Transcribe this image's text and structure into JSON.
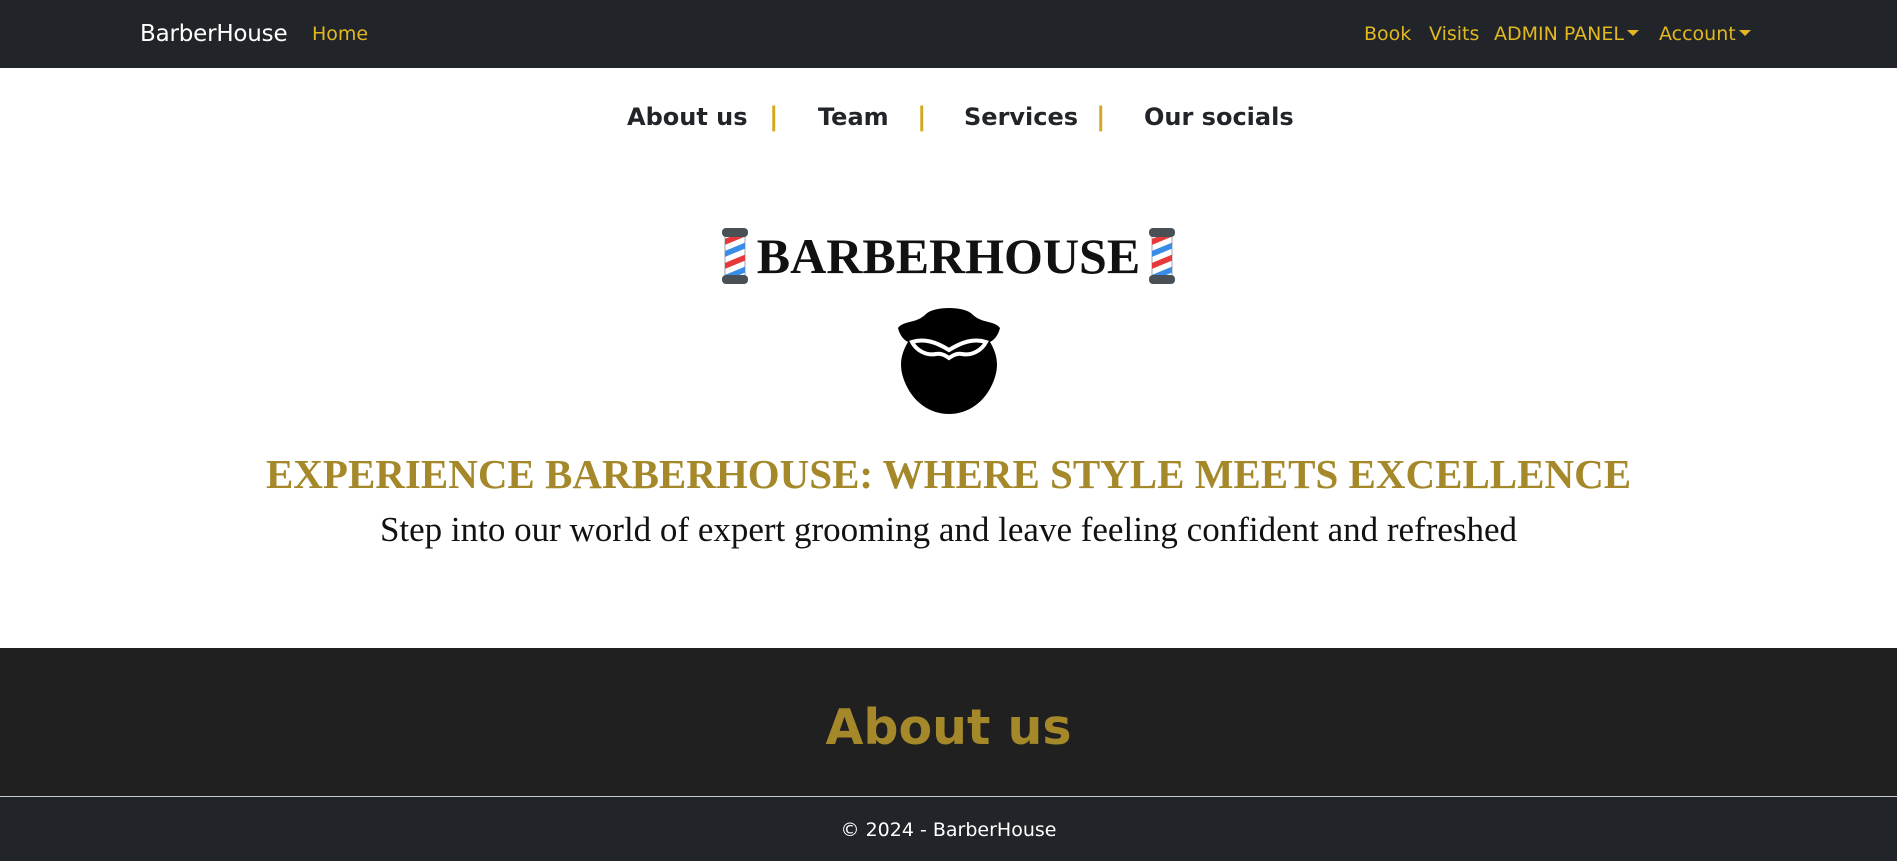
{
  "navbar": {
    "brand": "BarberHouse",
    "links": {
      "home": "Home",
      "book": "Book",
      "visits": "Visits",
      "admin": "ADMIN PANEL",
      "account": "Account"
    }
  },
  "section_nav": {
    "items": [
      "About us",
      "Team",
      "Services",
      "Our socials"
    ],
    "separator": "|"
  },
  "hero": {
    "title": "BARBERHOUSE",
    "heading": "EXPERIENCE BARBERHOUSE: WHERE STYLE MEETS EXCELLENCE",
    "subheading": "Step into our world of expert grooming and leave feeling confident and refreshed",
    "icons": [
      "barber-pole-icon",
      "beard-icon"
    ]
  },
  "about": {
    "title": "About us"
  },
  "footer": {
    "text": "© 2024 - BarberHouse"
  },
  "colors": {
    "navbar_bg": "#212529",
    "accent": "#e2b821",
    "gold_heading": "#a4882a",
    "about_bg": "#202020",
    "separator": "#d4a81e"
  }
}
